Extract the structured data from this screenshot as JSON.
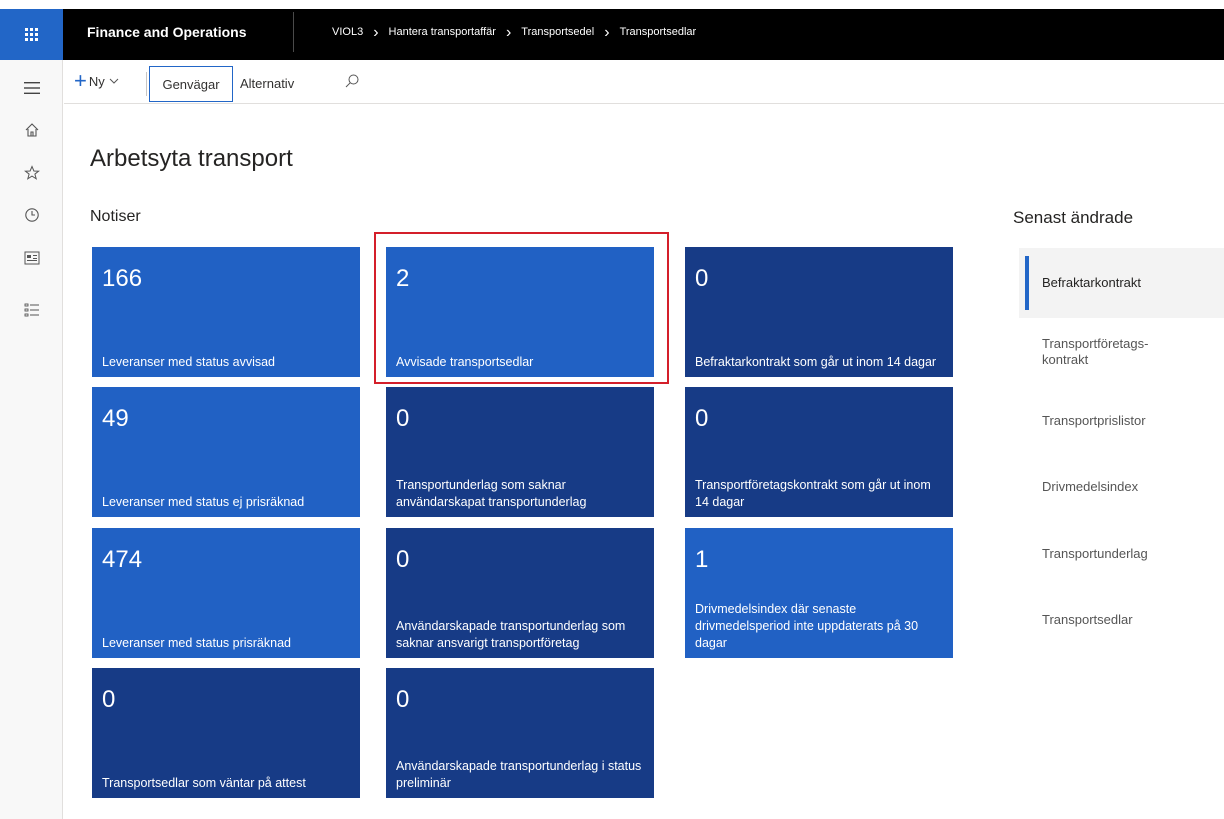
{
  "header": {
    "app_title": "Finance and Operations",
    "breadcrumb": [
      "VIOL3",
      "Hantera transportaffär",
      "Transportsedel",
      "Transportsedlar"
    ]
  },
  "leftnav": {
    "icons": [
      "menu-icon",
      "home-icon",
      "star-icon",
      "clock-icon",
      "workspace-icon",
      "list-icon"
    ]
  },
  "actionbar": {
    "new_label": "Ny",
    "tab_active": "Genvägar",
    "tab_other": "Alternativ"
  },
  "page": {
    "title": "Arbetsyta transport",
    "notices_title": "Notiser",
    "recent_title": "Senast ändrade"
  },
  "tiles": [
    {
      "count": "166",
      "label": "Leveranser med status avvisad",
      "style": "light"
    },
    {
      "count": "2",
      "label": "Avvisade transportsedlar",
      "style": "light"
    },
    {
      "count": "0",
      "label": "Befraktarkontrakt som går ut inom 14 dagar",
      "style": "dark"
    },
    {
      "count": "49",
      "label": "Leveranser med status ej prisräknad",
      "style": "light"
    },
    {
      "count": "0",
      "label": "Transportunderlag som saknar användarskapat transportunderlag",
      "style": "dark"
    },
    {
      "count": "0",
      "label": "Transportföretagskontrakt som går ut inom 14 dagar",
      "style": "dark"
    },
    {
      "count": "474",
      "label": "Leveranser med status prisräknad",
      "style": "light"
    },
    {
      "count": "0",
      "label": "Användarskapade transportunderlag som saknar ansvarigt transportföretag",
      "style": "dark"
    },
    {
      "count": "1",
      "label": "Drivmedelsindex där senaste drivmedelsperiod inte uppdaterats på 30 dagar",
      "style": "light"
    },
    {
      "count": "0",
      "label": "Transportsedlar som väntar på attest",
      "style": "dark"
    },
    {
      "count": "0",
      "label": "Användarskapade transportunderlag i status preliminär",
      "style": "dark"
    }
  ],
  "recent": [
    "Befraktarkontrakt",
    "Transportföretags-kontrakt",
    "Transportprislistor",
    "Drivmedelsindex",
    "Transportunderlag",
    "Transportsedlar"
  ],
  "colors": {
    "accent": "#2266c7",
    "tile_light": "#2161c4",
    "tile_dark": "#173b86",
    "highlight": "#d41f2a"
  }
}
